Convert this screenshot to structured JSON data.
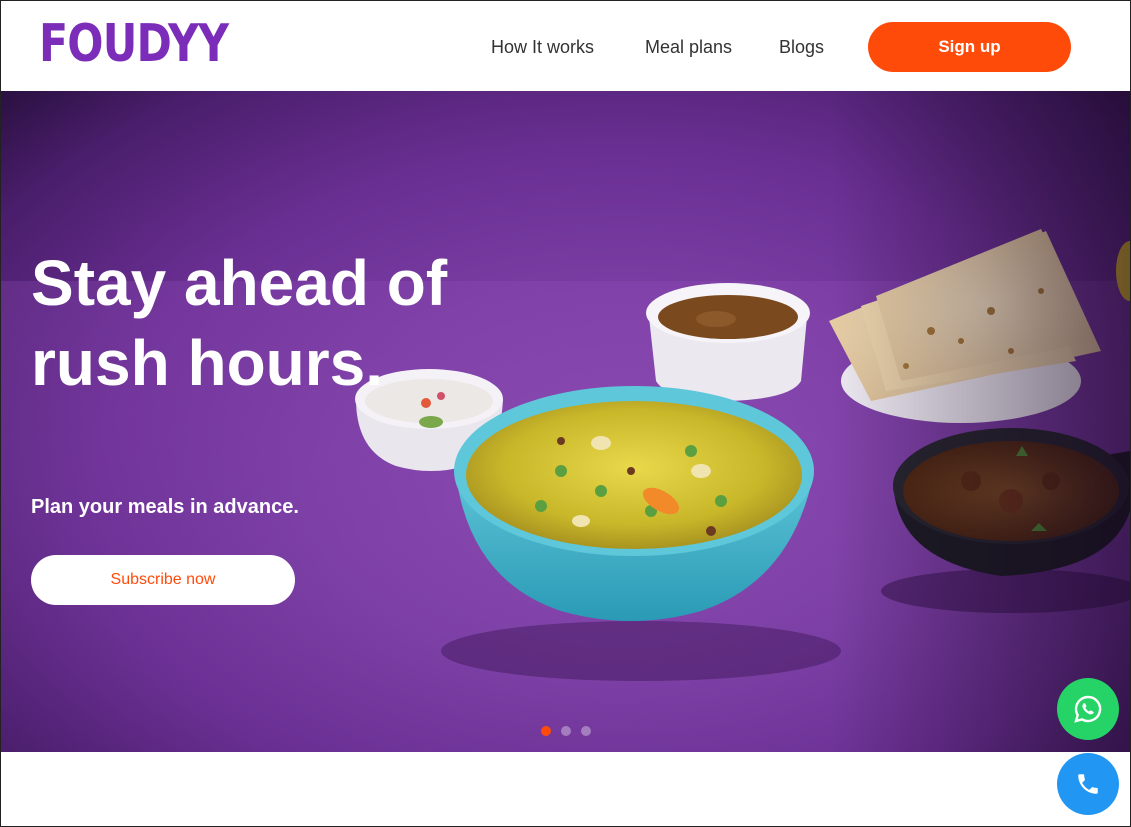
{
  "brand": {
    "logo_text": "FOUDYY",
    "color": "#7b2cb8"
  },
  "nav": {
    "items": [
      {
        "label": "How It works"
      },
      {
        "label": "Meal plans"
      },
      {
        "label": "Blogs"
      }
    ],
    "signup_label": "Sign up"
  },
  "hero": {
    "title": "Stay ahead of rush hours.",
    "subtitle": "Plan your meals in advance.",
    "cta_label": "Subscribe now",
    "slides": {
      "count": 3,
      "active": 1
    }
  },
  "floating_actions": [
    {
      "icon": "whatsapp-icon",
      "color": "#25d366"
    },
    {
      "icon": "phone-icon",
      "color": "#2196f3"
    }
  ],
  "colors": {
    "accent": "#ff4b0a",
    "hero_bg": "#7a3ea3"
  }
}
